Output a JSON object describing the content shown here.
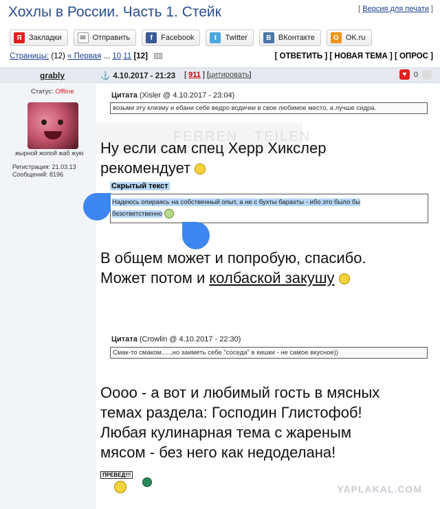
{
  "title": "Хохлы в России. Часть 1. Стейк",
  "print_link": "Версия для печати",
  "share_buttons": [
    {
      "icon": "ya-bookmarks-icon",
      "label": "Закладки",
      "color": "#e02020",
      "glyph": "Я"
    },
    {
      "icon": "mail-icon",
      "label": "Отправить",
      "color": "#9aa0a8",
      "glyph": "✉"
    },
    {
      "icon": "facebook-icon",
      "label": "Facebook",
      "color": "#3b5998",
      "glyph": "f"
    },
    {
      "icon": "twitter-icon",
      "label": "Twitter",
      "color": "#4aa8e0",
      "glyph": "t"
    },
    {
      "icon": "vk-icon",
      "label": "ВКонтакте",
      "color": "#4a76a8",
      "glyph": "В"
    },
    {
      "icon": "ok-icon",
      "label": "OK.ru",
      "color": "#f0941a",
      "glyph": "О"
    }
  ],
  "pages": {
    "label": "Страницы:",
    "count": "(12)",
    "first": "« Первая",
    "ellipsis": "...",
    "p10": "10",
    "p11": "11",
    "current": "[12]"
  },
  "actions": "[ ОТВЕТИТЬ ] [ НОВАЯ ТЕМА ] [ ОПРОС ]",
  "post": {
    "author": "grably",
    "datetime": "4.10.2017 - 21:23",
    "number": "911",
    "quote_link": "цитировать",
    "rating": "0"
  },
  "profile": {
    "status_label": "Статус:",
    "status_value": "Offline",
    "avatar_caption": "жырной жопой жаб жую",
    "registration": "Регистрация: 21.03.13",
    "messages": "Сообщений: 8196"
  },
  "watermark": {
    "left": "FERREN",
    "right": "TEILEN"
  },
  "quote1": {
    "label": "Цитата",
    "meta": "(Xisler @ 4.10.2017 - 23:04)",
    "text": "возьми эту клизму и ебани себе ведро водички в свое любимое место, а лучше сидра."
  },
  "text1_line1": "Ну если сам спец Херр Хикслер",
  "text1_line2": "рекомендует",
  "hidden_label": "Скрытый текст",
  "hidden_text_line1": "Надеюсь опираясь на собственный опыт, а не с бухты барахты - ибо это было бы",
  "hidden_text_line2": "безответственно",
  "text2_line1": "В общем может и попробую, спасибо.",
  "text2_line2_a": "Может потом и",
  "text2_line2_link": "колбаской закушу",
  "quote2": {
    "label": "Цитата",
    "meta": "(Crowlin @ 4.10.2017 - 22:30)",
    "text": "Смак-то смаком.....,но заиметь себе \"соседа\" в кишки - не самое вкусное))"
  },
  "text3_lines": [
    "Оооо - а вот и любимый гость в мясных",
    "темах раздела: Господин Глистофоб!",
    "Любая кулинарная тема с жареным",
    "мясом - без него как недоделана!"
  ],
  "preved_sign": "ПРЕВЕД!!!",
  "site_watermark": "YAPLAKAL.COM"
}
